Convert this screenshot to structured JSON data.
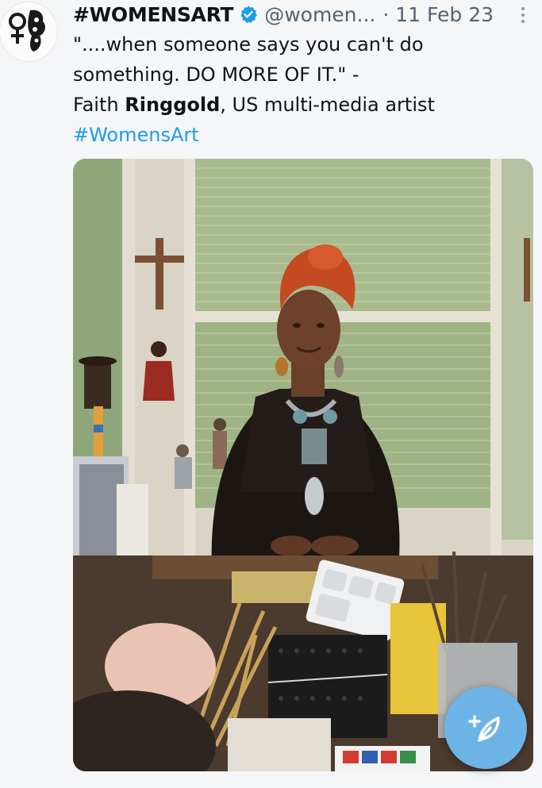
{
  "tweet": {
    "display_name": "#WOMENSART",
    "verified": true,
    "handle": "@women...",
    "timestamp": "· 11 Feb 23",
    "text_line1": "\"....when someone says you can't do",
    "text_line2": "something. DO MORE OF IT.\" -",
    "text_line3_pre": "Faith ",
    "text_line3_bold": "Ringgold",
    "text_line3_post": ", US multi-media artist",
    "hashtag": "#WomensArt",
    "colors": {
      "link": "#1d9bf0",
      "verified": "#1d9bf0",
      "secondary_text": "#536471",
      "fab": "#6cb4e6"
    }
  },
  "icons": {
    "verified": "verified-badge-icon",
    "more": "more-vertical-icon",
    "compose": "compose-feather-icon"
  }
}
